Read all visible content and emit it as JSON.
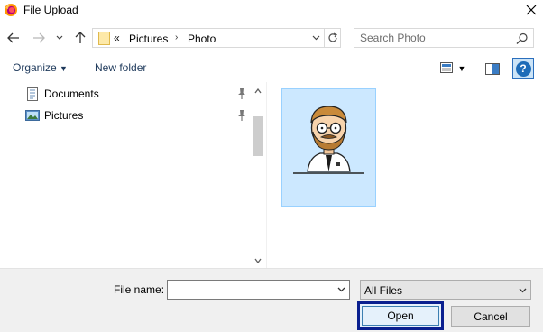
{
  "window": {
    "title": "File Upload",
    "app_icon": "firefox-icon",
    "close_icon": "close-icon"
  },
  "navigation": {
    "back_icon": "back-arrow-icon",
    "forward_icon": "forward-arrow-icon",
    "recent_icon": "chevron-down-icon",
    "up_icon": "up-arrow-icon"
  },
  "address": {
    "overflow_label": "«",
    "crumbs": [
      "Pictures",
      "Photo"
    ],
    "refresh_icon": "refresh-icon"
  },
  "search": {
    "placeholder": "Search Photo",
    "value": "",
    "icon": "search-icon"
  },
  "toolbar": {
    "organize_label": "Organize",
    "new_folder_label": "New folder",
    "help_label": "?"
  },
  "sidebar": {
    "items": [
      {
        "label": "Documents",
        "icon": "documents-icon",
        "pinned": true
      },
      {
        "label": "Pictures",
        "icon": "pictures-icon",
        "pinned": true
      }
    ]
  },
  "files": [
    {
      "name": "",
      "type": "image",
      "selected": true,
      "thumbnail": "man-with-glasses-avatar"
    }
  ],
  "footer": {
    "file_name_label": "File name:",
    "file_name_value": "",
    "file_type_value": "All Files",
    "open_label": "Open",
    "cancel_label": "Cancel"
  },
  "colors": {
    "selection_fill": "#cce8ff",
    "selection_border": "#99d1ff",
    "open_focus_border": "#0a1f8f",
    "help_blue": "#1e6cb8"
  }
}
